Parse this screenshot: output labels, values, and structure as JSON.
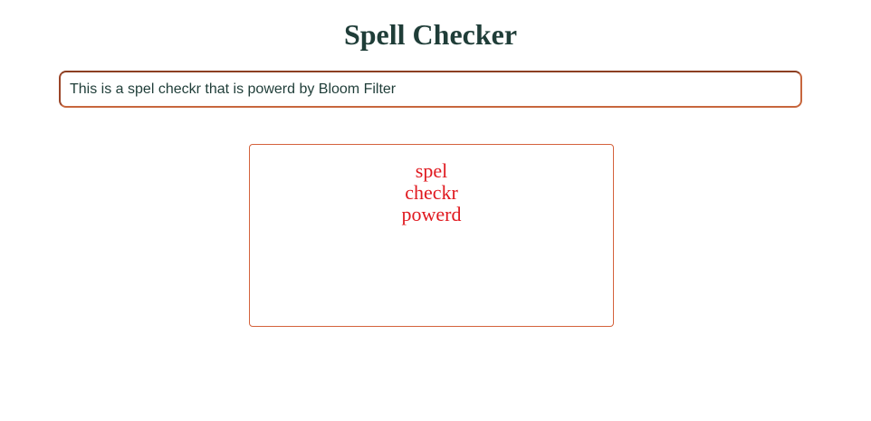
{
  "header": {
    "title": "Spell Checker"
  },
  "input": {
    "value": "This is a spel checkr that is powerd by Bloom Filter"
  },
  "results": {
    "misspelled_words": [
      "spel",
      "checkr",
      "powerd"
    ]
  },
  "colors": {
    "title": "#1f3d38",
    "input_border": "#c7663d",
    "box_border": "#d4623c",
    "misspelled_text": "#e0191f"
  }
}
